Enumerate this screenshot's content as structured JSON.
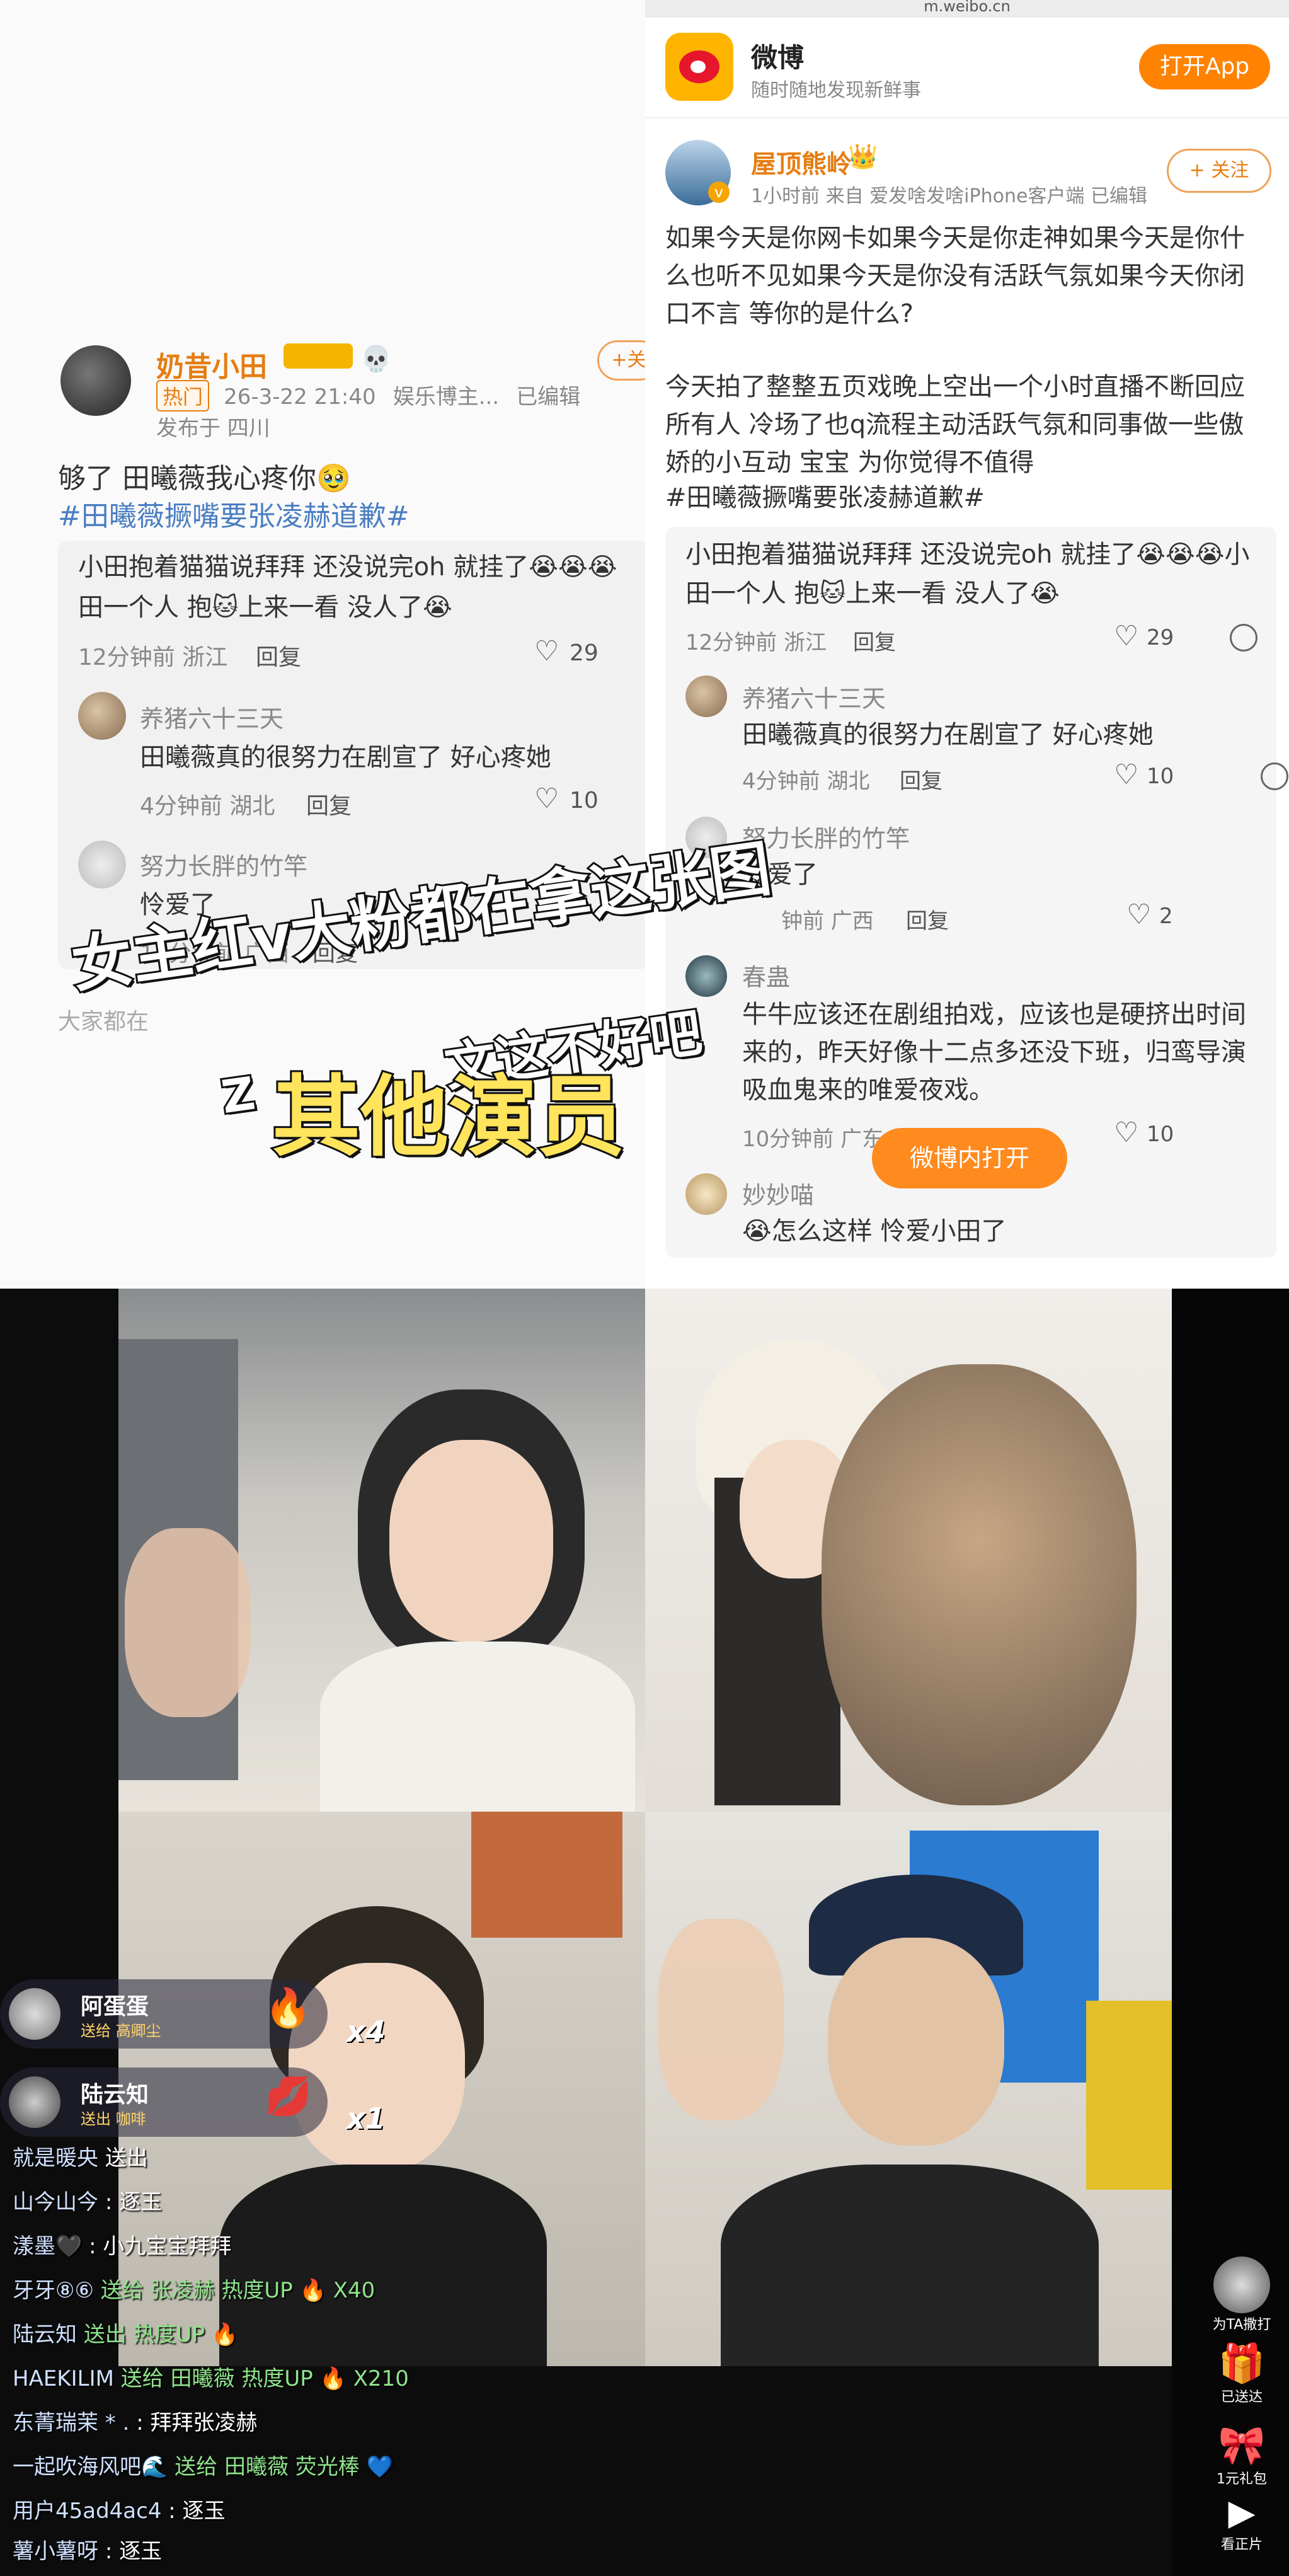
{
  "left_post": {
    "author": "奶昔小田",
    "hot_badge": "热门",
    "time": "26-3-22 21:40",
    "source": "娱乐博主...",
    "edited": "已编辑",
    "location": "发布于 四川",
    "follow": "+关",
    "text": "够了 田曦薇我心疼你🥹",
    "hashtag": "#田曦薇撅嘴要张凌赫道歉#",
    "quote_line1": "小田抱着猫猫说拜拜 还没说完oh 就挂了😭😭😭",
    "quote_line2": "田一个人 抱🐱上来一看 没人了😭",
    "quote_meta": "12分钟前 浙江",
    "reply_label": "回复",
    "quote_likes": "29",
    "comments": [
      {
        "name": "养猪六十三天",
        "text": "田曦薇真的很努力在剧宣了 好心疼她",
        "meta": "4分钟前 湖北",
        "likes": "10"
      },
      {
        "name": "努力长胖的竹竿",
        "text": "怜爱了",
        "meta": "11分钟前 广西",
        "likes": ""
      }
    ],
    "cutoff": "大家都在"
  },
  "captions": {
    "line1": "女主红v大粉都在拿这张图",
    "line2_prefix": "Z",
    "line2_partial": "文这不好吧",
    "line3": "其他演员"
  },
  "right_post": {
    "url": "m.weibo.cn",
    "app_name": "微博",
    "app_slogan": "随时随地发现新鲜事",
    "open_app": "打开App",
    "author": "屋顶熊岭",
    "author_badge": "👑",
    "meta": "1小时前 来自 爱发啥发啥iPhone客户端 已编辑",
    "follow": "+ 关注",
    "para1_l1": "如果今天是你网卡如果今天是你走神如果今天是你什",
    "para1_l2": "么也听不见如果今天是你没有活跃气氛如果今天你闭",
    "para1_l3": "口不言 等你的是什么?",
    "para2_l1": "今天拍了整整五页戏晚上空出一个小时直播不断回应",
    "para2_l2": "所有人 冷场了也q流程主动活跃气氛和同事做一些傲",
    "para2_l3": "娇的小互动 宝宝 为你觉得不值得",
    "hashtag": "#田曦薇撅嘴要张凌赫道歉#",
    "quote_l1": "小田抱着猫猫说拜拜 还没说完oh 就挂了😭😭😭小",
    "quote_l2": "田一个人 抱🐱上来一看 没人了😭",
    "quote_meta": "12分钟前 浙江",
    "reply_label": "回复",
    "quote_likes": "29",
    "comments": [
      {
        "name": "养猪六十三天",
        "text": "田曦薇真的很努力在剧宣了 好心疼她",
        "meta": "4分钟前 湖北",
        "likes": "10"
      },
      {
        "name": "努力长胖的竹竿",
        "text": "怜爱了",
        "meta": "钟前 广西",
        "likes": "2"
      },
      {
        "name": "春蛊",
        "text1": "牛牛应该还在剧组拍戏，应该也是硬挤出时间",
        "text2": "来的，昨天好像十二点多还没下班，归鸾导演",
        "text3": "吸血鬼来的唯爱夜戏。",
        "meta": "10分钟前 广东",
        "likes": "10"
      },
      {
        "name": "妙妙喵",
        "text": "😭怎么这样 怜爱小田了"
      }
    ],
    "open_in_weibo": "微博内打开"
  },
  "live": {
    "gift1": {
      "name": "阿蛋蛋",
      "sub": "送给 高卿尘",
      "count": "x4"
    },
    "gift2": {
      "name": "陆云知",
      "sub": "送出 咖啡",
      "count": "x1"
    },
    "chat": [
      {
        "user": "就是暖央",
        "msg": "送出"
      },
      {
        "user": "山今山今",
        "msg": ": 逐玉"
      },
      {
        "user": "漾墨🖤",
        "msg": ": 小九宝宝拜拜"
      },
      {
        "user": "牙牙⑧⑥",
        "msg": "送给 张凌赫 热度UP 🔥 X40"
      },
      {
        "user": "陆云知",
        "msg": "送出 热度UP 🔥"
      },
      {
        "user": "HAEKILIM",
        "msg": "送给 田曦薇 热度UP 🔥 X210"
      },
      {
        "user": "东菁瑞茉 * .",
        "msg": ": 拜拜张凌赫"
      },
      {
        "user": "一起吹海风吧🌊",
        "msg": "送给 田曦薇 荧光棒 💙"
      },
      {
        "user": "用户45ad4ac4",
        "msg": ": 逐玉"
      },
      {
        "user": "薯小薯呀",
        "msg": ": 逐玉"
      }
    ],
    "side_buttons": [
      "为TA撒打",
      "已送达",
      "1元礼包",
      "看正片"
    ]
  }
}
